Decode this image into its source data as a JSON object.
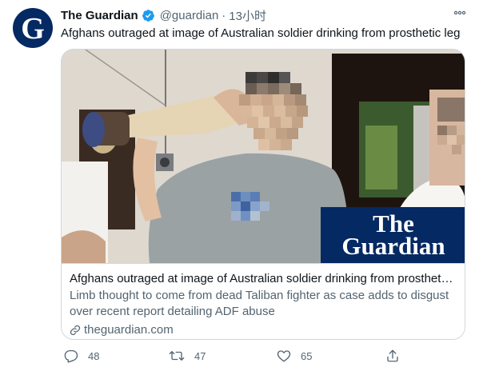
{
  "account": {
    "display_name": "The Guardian",
    "handle": "@guardian",
    "time": "13小时",
    "avatar_letter": "G"
  },
  "tweet": {
    "text": "Afghans outraged at image of Australian soldier drinking from prosthetic leg"
  },
  "card": {
    "logo_line1": "The",
    "logo_line2": "Guardian",
    "title": "Afghans outraged at image of Australian soldier drinking from prosthetic leg",
    "description": "Limb thought to come from dead Taliban fighter as case adds to disgust over recent report detailing ADF abuse",
    "domain": "theguardian.com"
  },
  "actions": {
    "reply_count": "48",
    "retweet_count": "47",
    "like_count": "65"
  },
  "colors": {
    "brand": "#052962",
    "text": "#0f1419",
    "muted": "#536471",
    "verified": "#1d9bf0",
    "border": "#cfd9de"
  }
}
